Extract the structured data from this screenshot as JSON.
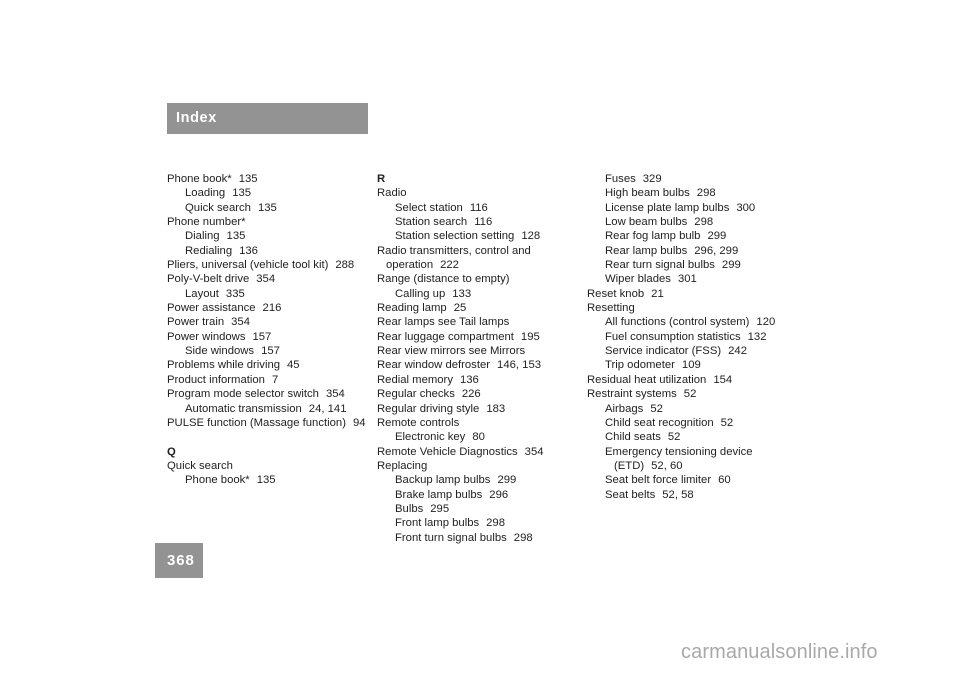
{
  "page": {
    "header_label": "Index",
    "page_number": "368",
    "watermark": "carmanualsonline.info",
    "accent_gray": "#939393",
    "watermark_color": "#a9a9a9"
  },
  "columns": [
    {
      "id": "column-1",
      "entries": [
        {
          "level": 1,
          "term": "Phone book*",
          "pages": "135"
        },
        {
          "level": 2,
          "term": "Loading",
          "pages": "135"
        },
        {
          "level": 2,
          "term": "Quick search",
          "pages": "135"
        },
        {
          "level": 1,
          "term": "Phone number*",
          "pages": ""
        },
        {
          "level": 2,
          "term": "Dialing",
          "pages": "135"
        },
        {
          "level": 2,
          "term": "Redialing",
          "pages": "136"
        },
        {
          "level": 1,
          "term": "Pliers, universal (vehicle tool kit)",
          "pages": "288"
        },
        {
          "level": 1,
          "term": "Poly-V-belt drive",
          "pages": "354"
        },
        {
          "level": 2,
          "term": "Layout",
          "pages": "335"
        },
        {
          "level": 1,
          "term": "Power assistance",
          "pages": "216"
        },
        {
          "level": 1,
          "term": "Power train",
          "pages": "354"
        },
        {
          "level": 1,
          "term": "Power windows",
          "pages": "157"
        },
        {
          "level": 2,
          "term": "Side windows",
          "pages": "157"
        },
        {
          "level": 1,
          "term": "Problems while driving",
          "pages": "45"
        },
        {
          "level": 1,
          "term": "Product information",
          "pages": "7"
        },
        {
          "level": 1,
          "term": "Program mode selector switch",
          "pages": "354"
        },
        {
          "level": 2,
          "term": "Automatic transmission",
          "pages": "24, 141"
        },
        {
          "level": 1,
          "term": "PULSE function (Massage function)",
          "pages": "94"
        },
        {
          "level": 0,
          "term": "",
          "pages": ""
        },
        {
          "level": 1,
          "term": "Q",
          "pages": "",
          "heading": true
        },
        {
          "level": 1,
          "term": "Quick search",
          "pages": ""
        },
        {
          "level": 2,
          "term": "Phone book*",
          "pages": "135"
        }
      ]
    },
    {
      "id": "column-2",
      "entries": [
        {
          "level": 1,
          "term": "R",
          "pages": "",
          "heading": true
        },
        {
          "level": 1,
          "term": "Radio",
          "pages": ""
        },
        {
          "level": 2,
          "term": "Select station",
          "pages": "116"
        },
        {
          "level": 2,
          "term": "Station search",
          "pages": "116"
        },
        {
          "level": 2,
          "term": "Station selection setting",
          "pages": "128"
        },
        {
          "level": 1,
          "term": "Radio transmitters, control and",
          "pages": ""
        },
        {
          "level": 4,
          "term": "operation",
          "pages": "222"
        },
        {
          "level": 1,
          "term": "Range (distance to empty)",
          "pages": ""
        },
        {
          "level": 2,
          "term": "Calling up",
          "pages": "133"
        },
        {
          "level": 1,
          "term": "Reading lamp",
          "pages": "25"
        },
        {
          "level": 1,
          "term": "Rear lamps see Tail lamps",
          "pages": ""
        },
        {
          "level": 1,
          "term": "Rear luggage compartment",
          "pages": "195"
        },
        {
          "level": 1,
          "term": "Rear view mirrors see Mirrors",
          "pages": ""
        },
        {
          "level": 1,
          "term": "Rear window defroster",
          "pages": "146, 153"
        },
        {
          "level": 1,
          "term": "Redial memory",
          "pages": "136"
        },
        {
          "level": 1,
          "term": "Regular checks",
          "pages": "226"
        },
        {
          "level": 1,
          "term": "Regular driving style",
          "pages": "183"
        },
        {
          "level": 1,
          "term": "Remote controls",
          "pages": ""
        },
        {
          "level": 2,
          "term": "Electronic key",
          "pages": "80"
        },
        {
          "level": 1,
          "term": "Remote Vehicle Diagnostics",
          "pages": "354"
        },
        {
          "level": 1,
          "term": "Replacing",
          "pages": ""
        },
        {
          "level": 2,
          "term": "Backup lamp bulbs",
          "pages": "299"
        },
        {
          "level": 2,
          "term": "Brake lamp bulbs",
          "pages": "296"
        },
        {
          "level": 2,
          "term": "Bulbs",
          "pages": "295"
        },
        {
          "level": 2,
          "term": "Front lamp bulbs",
          "pages": "298"
        },
        {
          "level": 2,
          "term": "Front turn signal bulbs",
          "pages": "298"
        }
      ]
    },
    {
      "id": "column-3",
      "entries": [
        {
          "level": 2,
          "term": "Fuses",
          "pages": "329"
        },
        {
          "level": 2,
          "term": "High beam bulbs",
          "pages": "298"
        },
        {
          "level": 2,
          "term": "License plate lamp bulbs",
          "pages": "300"
        },
        {
          "level": 2,
          "term": "Low beam bulbs",
          "pages": "298"
        },
        {
          "level": 2,
          "term": "Rear fog lamp bulb",
          "pages": "299"
        },
        {
          "level": 2,
          "term": "Rear lamp bulbs",
          "pages": "296, 299"
        },
        {
          "level": 2,
          "term": "Rear turn signal bulbs",
          "pages": "299"
        },
        {
          "level": 2,
          "term": "Wiper blades",
          "pages": "301"
        },
        {
          "level": 1,
          "term": "Reset knob",
          "pages": "21"
        },
        {
          "level": 1,
          "term": "Resetting",
          "pages": ""
        },
        {
          "level": 2,
          "term": "All functions (control system)",
          "pages": "120"
        },
        {
          "level": 2,
          "term": "Fuel consumption statistics",
          "pages": "132"
        },
        {
          "level": 2,
          "term": "Service indicator (FSS)",
          "pages": "242"
        },
        {
          "level": 2,
          "term": "Trip odometer",
          "pages": "109"
        },
        {
          "level": 1,
          "term": "Residual heat utilization",
          "pages": "154"
        },
        {
          "level": 1,
          "term": "Restraint systems",
          "pages": "52"
        },
        {
          "level": 2,
          "term": "Airbags",
          "pages": "52"
        },
        {
          "level": 2,
          "term": "Child seat recognition",
          "pages": "52"
        },
        {
          "level": 2,
          "term": "Child seats",
          "pages": "52"
        },
        {
          "level": 2,
          "term": "Emergency tensioning device",
          "pages": ""
        },
        {
          "level": 3,
          "term": "(ETD)",
          "pages": "52, 60"
        },
        {
          "level": 2,
          "term": "Seat belt force limiter",
          "pages": "60"
        },
        {
          "level": 2,
          "term": "Seat belts",
          "pages": "52, 58"
        }
      ]
    }
  ]
}
